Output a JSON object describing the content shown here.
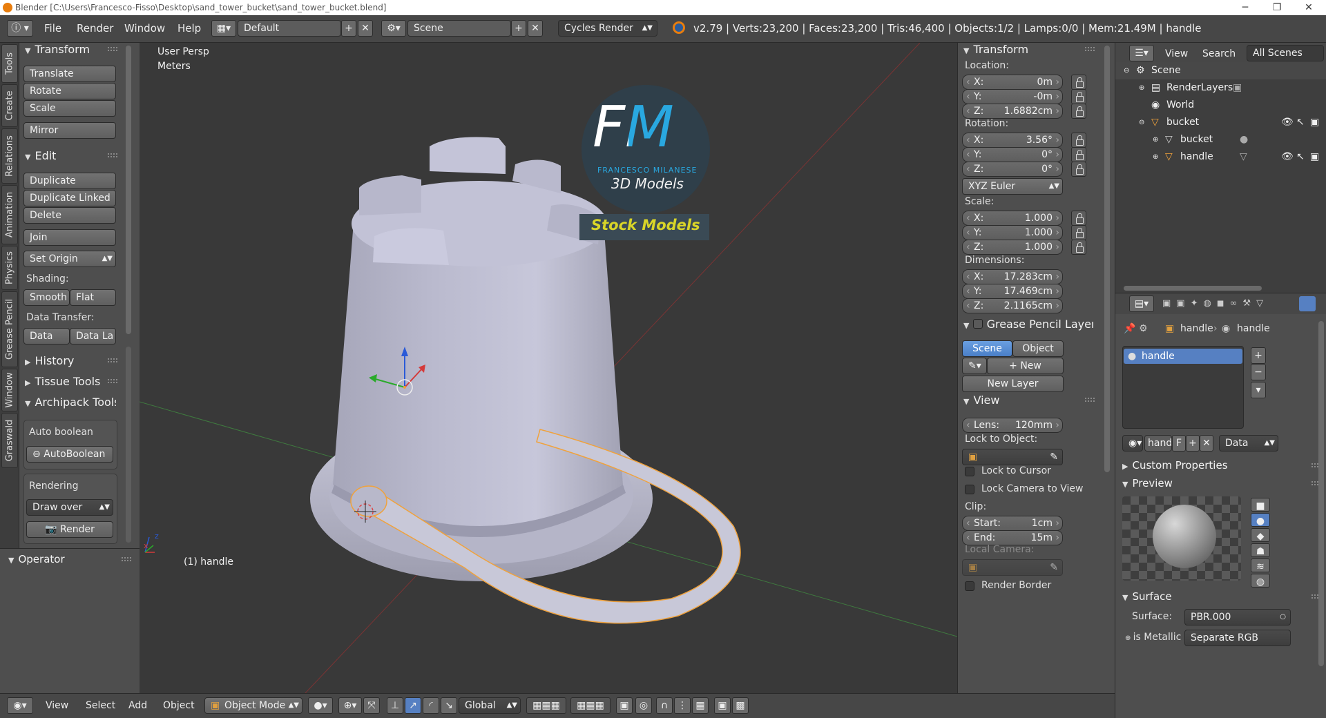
{
  "window": {
    "title": "Blender [C:\\Users\\Francesco-Fisso\\Desktop\\sand_tower_bucket\\sand_tower_bucket.blend]",
    "minimize": "─",
    "restore": "❐",
    "close": "✕"
  },
  "infobar": {
    "menus": [
      "File",
      "Render",
      "Window",
      "Help"
    ],
    "screen_layout": "Default",
    "scene": "Scene",
    "render_engine": "Cycles Render",
    "stats": "v2.79 | Verts:23,200 | Faces:23,200 | Tris:46,400 | Objects:1/2 | Lamps:0/0 | Mem:21.49M | handle"
  },
  "tool_tabs": [
    "Tools",
    "Create",
    "Relations",
    "Animation",
    "Physics",
    "Grease Pencil",
    "Window",
    "Graswald"
  ],
  "tool_shelf": {
    "transform": {
      "header": "Transform",
      "buttons": [
        "Translate",
        "Rotate",
        "Scale",
        "Mirror"
      ]
    },
    "edit": {
      "header": "Edit",
      "buttons": [
        "Duplicate",
        "Duplicate Linked",
        "Delete",
        "Join",
        "Set Origin"
      ]
    },
    "shading": {
      "label": "Shading:",
      "smooth": "Smooth",
      "flat": "Flat"
    },
    "data_transfer": {
      "label": "Data Transfer:",
      "data": "Data",
      "data_layout": "Data La"
    },
    "collapsed": [
      "History",
      "Tissue Tools"
    ],
    "archipack": {
      "header": "Archipack Tools",
      "auto_boolean_label": "Auto boolean",
      "auto_boolean_btn": "AutoBoolean",
      "rendering_label": "Rendering",
      "draw_over": "Draw over",
      "render_btn": "Render"
    },
    "operator": "Operator"
  },
  "viewport": {
    "view_label": "User Persp",
    "units_label": "Meters",
    "object_label": "(1) handle",
    "watermark": {
      "letters": "FM",
      "company": "FRANCESCO MILANESE",
      "subtitle": "3D Models",
      "banner": "Stock Models"
    },
    "axis_x": "x",
    "axis_z": "z"
  },
  "n_panel": {
    "transform_header": "Transform",
    "location_label": "Location:",
    "location": [
      {
        "k": "X:",
        "v": "0m"
      },
      {
        "k": "Y:",
        "v": "-0m"
      },
      {
        "k": "Z:",
        "v": "1.6882cm"
      }
    ],
    "rotation_label": "Rotation:",
    "rotation": [
      {
        "k": "X:",
        "v": "3.56°"
      },
      {
        "k": "Y:",
        "v": "0°"
      },
      {
        "k": "Z:",
        "v": "0°"
      }
    ],
    "rotation_mode": "XYZ Euler",
    "scale_label": "Scale:",
    "scale": [
      {
        "k": "X:",
        "v": "1.000"
      },
      {
        "k": "Y:",
        "v": "1.000"
      },
      {
        "k": "Z:",
        "v": "1.000"
      }
    ],
    "dimensions_label": "Dimensions:",
    "dimensions": [
      {
        "k": "X:",
        "v": "17.283cm"
      },
      {
        "k": "Y:",
        "v": "17.469cm"
      },
      {
        "k": "Z:",
        "v": "2.1165cm"
      }
    ],
    "grease_pencil_header": "Grease Pencil Layer",
    "gp_scene": "Scene",
    "gp_object": "Object",
    "gp_new": "New",
    "gp_new_layer": "New Layer",
    "view_header": "View",
    "lens": {
      "k": "Lens:",
      "v": "120mm"
    },
    "lock_to_object_label": "Lock to Object:",
    "lock_to_cursor": "Lock to Cursor",
    "lock_camera": "Lock Camera to View",
    "clip_label": "Clip:",
    "clip_start": {
      "k": "Start:",
      "v": "1cm"
    },
    "clip_end": {
      "k": "End:",
      "v": "15m"
    },
    "local_camera_label": "Local Camera:",
    "render_border": "Render Border"
  },
  "outliner": {
    "menu_view": "View",
    "menu_search": "Search",
    "filter": "All Scenes",
    "items": [
      "Scene",
      "RenderLayers",
      "World",
      "bucket",
      "bucket",
      "handle"
    ]
  },
  "properties": {
    "breadcrumb_object": "handle",
    "breadcrumb_material": "handle",
    "material_slot": "handle",
    "material_name": "handl",
    "fake_user": "F",
    "link": "Data",
    "custom_properties": "Custom Properties",
    "preview": "Preview",
    "surface_header": "Surface",
    "surface_label": "Surface:",
    "surface_value": "PBR.000",
    "metallic_label": "is Metallic",
    "metallic_value": "Separate RGB"
  },
  "bottombar": {
    "menus": [
      "View",
      "Select",
      "Add",
      "Object"
    ],
    "mode": "Object Mode",
    "orientation": "Global"
  },
  "colors": {
    "accent_blue": "#5680c2",
    "selection_orange": "#f0a23c",
    "watermark_yellow": "#d9d528",
    "watermark_cyan": "#29a8e0"
  }
}
